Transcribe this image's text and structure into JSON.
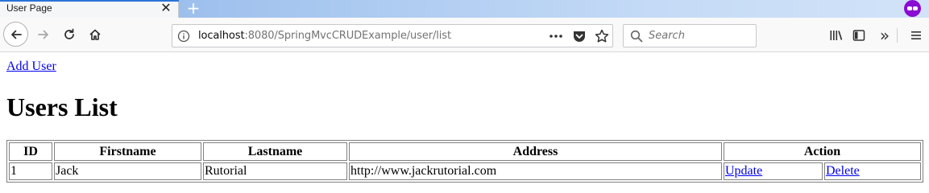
{
  "browser": {
    "tab": {
      "title": "User Page",
      "close_glyph": "✕"
    },
    "new_tab_glyph": "+",
    "url": {
      "host": "localhost",
      "rest": ":8080/SpringMvcCRUDExample/user/list"
    },
    "search": {
      "placeholder": "Search"
    },
    "overflow_glyph": "»",
    "accent_color": "#2a74d9",
    "private_color": "#8a0bd2"
  },
  "page": {
    "add_user_link": "Add User",
    "title": "Users List",
    "table": {
      "headers": {
        "id": "ID",
        "firstname": "Firstname",
        "lastname": "Lastname",
        "address": "Address",
        "action": "Action"
      },
      "rows": [
        {
          "id": "1",
          "firstname": "Jack",
          "lastname": "Rutorial",
          "address": "http://www.jackrutorial.com",
          "update": "Update",
          "delete": "Delete"
        }
      ]
    }
  }
}
